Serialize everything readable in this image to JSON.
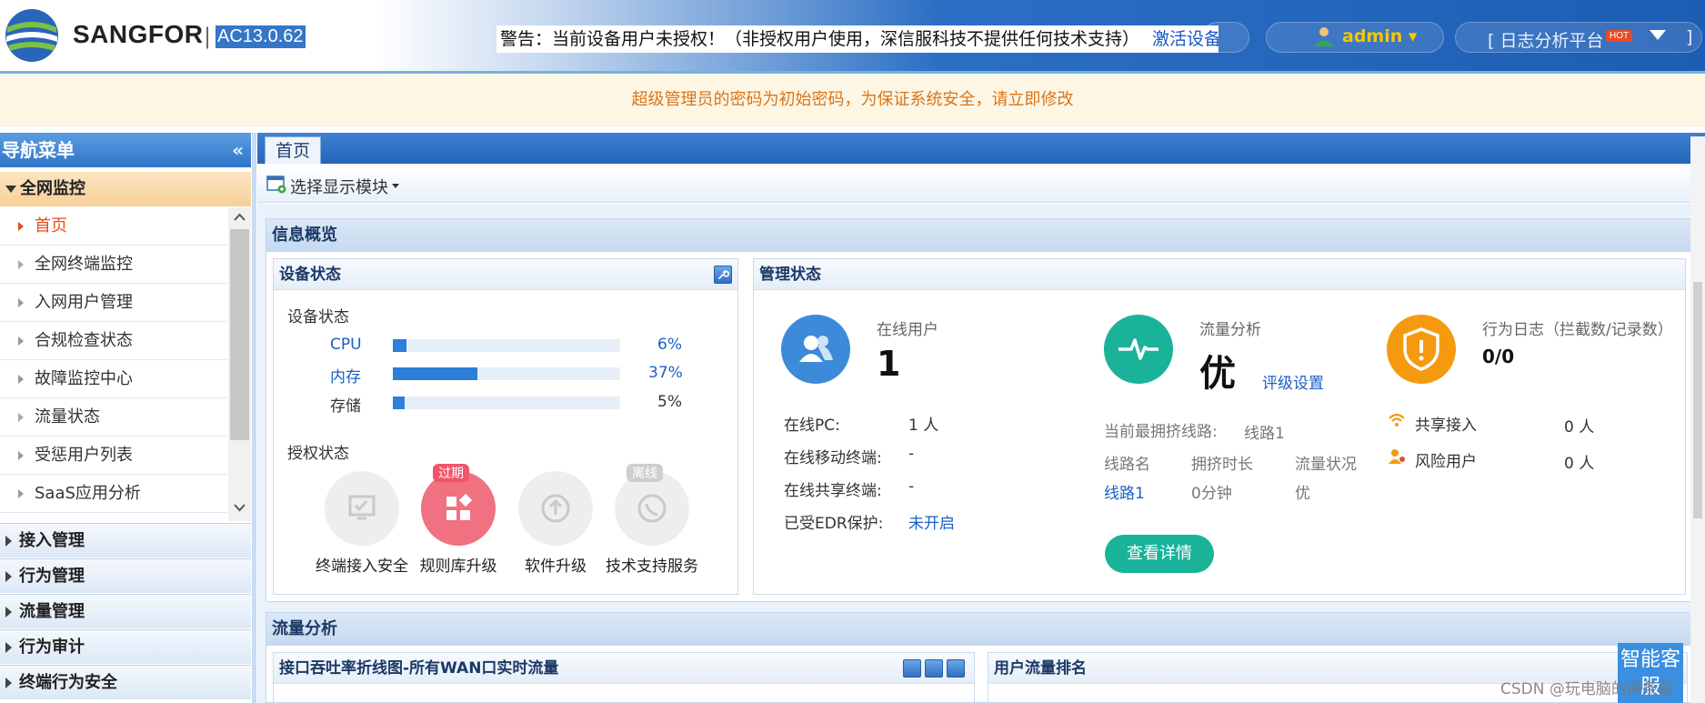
{
  "header": {
    "brand": "SANGFOR",
    "separator": "|",
    "version": "AC13.0.62",
    "warning": "警告：当前设备用户未授权！（非授权用户使用，深信服科技不提供任何技术支持）",
    "activate_link": "激活设备授权",
    "user": "admin",
    "log_platform": "[ 日志分析平台",
    "hot_badge": "HOT",
    "bracket_close": "]"
  },
  "notice": "超级管理员的密码为初始密码，为保证系统安全，请立即修改",
  "nav": {
    "title": "导航菜单",
    "collapse": "«",
    "open_group": "全网监控",
    "items": [
      {
        "label": "首页",
        "active": true
      },
      {
        "label": "全网终端监控"
      },
      {
        "label": "入网用户管理"
      },
      {
        "label": "合规检查状态"
      },
      {
        "label": "故障监控中心"
      },
      {
        "label": "流量状态"
      },
      {
        "label": "受惩用户列表"
      },
      {
        "label": "SaaS应用分析"
      }
    ],
    "groups": [
      "接入管理",
      "行为管理",
      "流量管理",
      "行为审计",
      "终端行为安全"
    ]
  },
  "tabs": {
    "home": "首页"
  },
  "toolbar": {
    "module_select": "选择显示模块"
  },
  "overview": {
    "title": "信息概览",
    "device": {
      "title": "设备状态",
      "subtitle": "设备状态",
      "rows": [
        {
          "name": "CPU",
          "value": "6%",
          "percent": 6
        },
        {
          "name": "内存",
          "value": "37%",
          "percent": 37
        },
        {
          "name": "存储",
          "value": "5%",
          "percent": 5
        }
      ],
      "license_title": "授权状态",
      "licenses": [
        {
          "label": "终端接入安全",
          "badge": ""
        },
        {
          "label": "规则库升级",
          "badge": "过期"
        },
        {
          "label": "软件升级",
          "badge": ""
        },
        {
          "label": "技术支持服务",
          "badge": "离线"
        }
      ]
    },
    "manage": {
      "title": "管理状态",
      "online_users_label": "在线用户",
      "online_users": "1",
      "online_pc_label": "在线PC:",
      "online_pc": "1 人",
      "mobile_label": "在线移动终端:",
      "mobile": "-",
      "shared_label": "在线共享终端:",
      "shared": "-",
      "edr_label": "已受EDR保护:",
      "edr": "未开启",
      "traffic_label": "流量分析",
      "traffic_value": "优",
      "rating_link": "评级设置",
      "congested_label": "当前最拥挤线路:",
      "congested_value": "线路1",
      "table_headers": [
        "线路名",
        "拥挤时长",
        "流量状况"
      ],
      "table_row": [
        "线路1",
        "0分钟",
        "优"
      ],
      "detail_button": "查看详情",
      "behavior_label": "行为日志（拦截数/记录数）",
      "behavior_value": "0/0",
      "shared_access_label": "共享接入",
      "shared_access_value": "0 人",
      "risk_label": "风险用户",
      "risk_value": "0 人"
    }
  },
  "flow": {
    "title": "流量分析",
    "chart_panel": "接口吞吐率折线图-所有WAN口实时流量",
    "rank_panel": "用户流量排名"
  },
  "assistant": "智能客服",
  "watermark": "CSDN @玩电脑的辣条哥",
  "colors": {
    "accent": "#2f74c8",
    "notice": "#d9751a",
    "active": "#e44d1d",
    "teal": "#1ab39a",
    "orange": "#f59a0f"
  }
}
